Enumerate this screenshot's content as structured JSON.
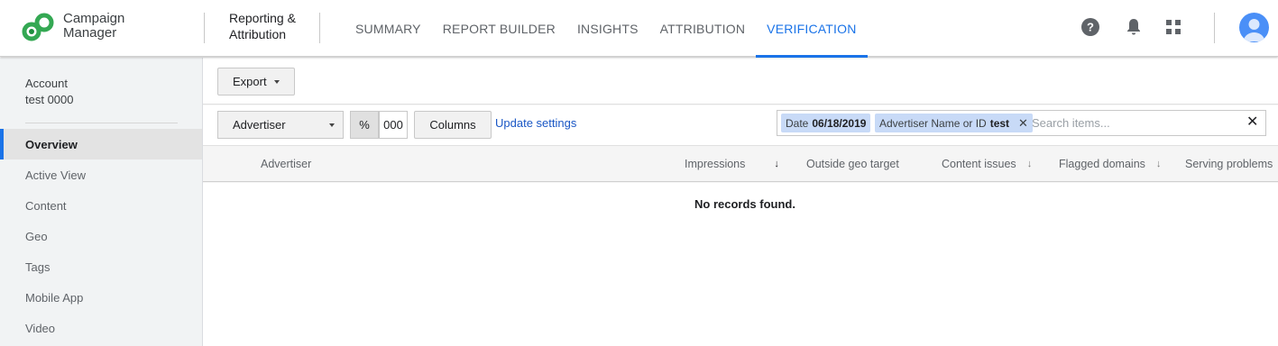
{
  "header": {
    "brand_line1": "Campaign",
    "brand_line2": "Manager",
    "product_line1": "Reporting &",
    "product_line2": "Attribution",
    "tabs": [
      {
        "label": "SUMMARY"
      },
      {
        "label": "REPORT BUILDER"
      },
      {
        "label": "INSIGHTS"
      },
      {
        "label": "ATTRIBUTION"
      },
      {
        "label": "VERIFICATION",
        "active": true
      }
    ],
    "icons": [
      "help-icon",
      "notifications-icon",
      "apps-grid-icon",
      "account-avatar-icon"
    ]
  },
  "sidebar": {
    "account_label": "Account",
    "account_value": "test 0000",
    "items": [
      {
        "label": "Overview",
        "active": true
      },
      {
        "label": "Active View"
      },
      {
        "label": "Content"
      },
      {
        "label": "Geo"
      },
      {
        "label": "Tags"
      },
      {
        "label": "Mobile App"
      },
      {
        "label": "Video"
      }
    ]
  },
  "toolbar": {
    "export_label": "Export",
    "dimension_select": "Advertiser",
    "percent_label": "%",
    "thousands_label": "000",
    "columns_label": "Columns",
    "update_link": "Update settings",
    "filters": [
      {
        "key": "Date",
        "value": "06/18/2019"
      },
      {
        "key": "Advertiser Name or ID",
        "value": "test"
      }
    ],
    "search_placeholder": "Search items..."
  },
  "table": {
    "columns": [
      "Advertiser",
      "Impressions",
      "Outside geo target",
      "Content issues",
      "Flagged domains",
      "Serving problems"
    ],
    "sorted_column": "Impressions",
    "empty_message": "No records found."
  },
  "colors": {
    "accent": "#1a73e8",
    "chip_bg": "#c8daf7",
    "sidebar_bg": "#f1f3f4"
  }
}
